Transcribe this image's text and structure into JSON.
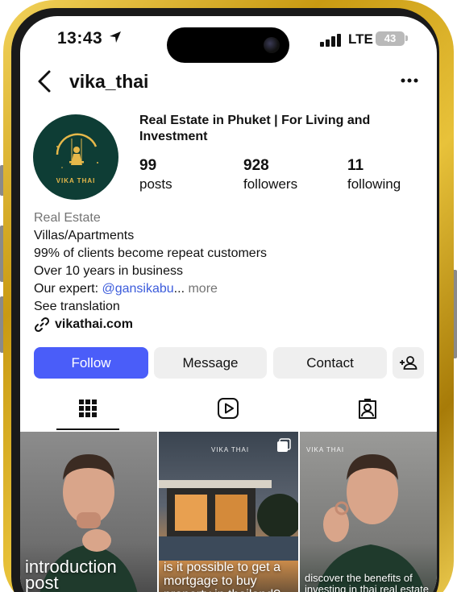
{
  "status_bar": {
    "time": "13:43",
    "network": "LTE",
    "battery": "43"
  },
  "header": {
    "username": "vika_thai"
  },
  "profile": {
    "avatar_brand": "VIKA THAI",
    "name": "Real Estate in Phuket | For Living and Investment",
    "stats": [
      {
        "value": "99",
        "label": "posts"
      },
      {
        "value": "928",
        "label": "followers"
      },
      {
        "value": "11",
        "label": "following"
      }
    ],
    "bio": {
      "category": "Real Estate",
      "lines": [
        "Villas/Apartments",
        "99% of clients become repeat customers",
        "Over 10 years in business"
      ],
      "expert_prefix": "Our expert: ",
      "expert_mention": "@gansikabu",
      "ellipsis": "...",
      "more": " more",
      "see_translation": "See translation",
      "link": "vikathai.com"
    }
  },
  "actions": {
    "follow": "Follow",
    "message": "Message",
    "contact": "Contact"
  },
  "tabs": [
    {
      "name": "grid",
      "icon": "grid-icon",
      "active": true
    },
    {
      "name": "reels",
      "icon": "reels-icon",
      "active": false
    },
    {
      "name": "tagged",
      "icon": "tagged-icon",
      "active": false
    }
  ],
  "posts": [
    {
      "caption": "introduction post",
      "logo": ""
    },
    {
      "caption": "is it possible to get a mortgage to buy property in thailand?",
      "logo": "VIKA THAI"
    },
    {
      "caption": "discover the benefits of investing in thai real estate",
      "logo": "VIKA THAI"
    }
  ],
  "colors": {
    "accent": "#4a5df9",
    "mention": "#3b5bdb",
    "avatar_bg": "#0e3d35",
    "brand_gold": "#e6b84a",
    "frame_gold": "#d4a81e"
  }
}
